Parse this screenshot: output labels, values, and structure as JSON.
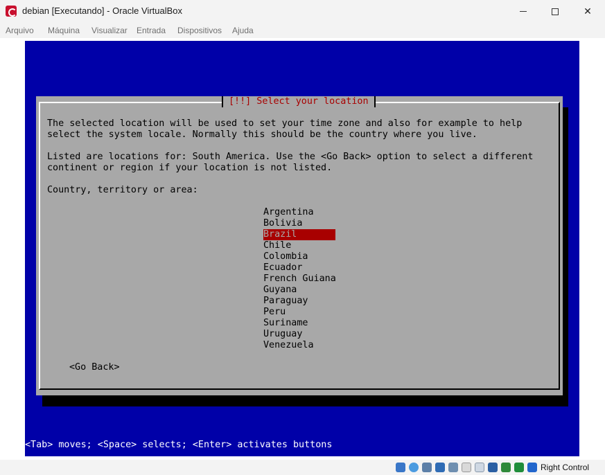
{
  "window": {
    "title": "debian [Executando] - Oracle VirtualBox",
    "minimize_glyph": "—",
    "maximize_glyph": "☐",
    "close_glyph": "✕"
  },
  "menu": [
    "Arquivo",
    "Máquina",
    "Visualizar",
    "Entrada",
    "Dispositivos",
    "Ajuda"
  ],
  "installer": {
    "dialog_title": "[!!] Select your location",
    "intro_lines": [
      "The selected location will be used to set your time zone and also for example to help",
      "select the system locale. Normally this should be the country where you live."
    ],
    "listed_lines": [
      "Listed are locations for: South America. Use the <Go Back> option to select a different",
      "continent or region if your location is not listed."
    ],
    "prompt": "Country, territory or area:",
    "countries": [
      "Argentina",
      "Bolivia",
      "Brazil",
      "Chile",
      "Colombia",
      "Ecuador",
      "French Guiana",
      "Guyana",
      "Paraguay",
      "Peru",
      "Suriname",
      "Uruguay",
      "Venezuela"
    ],
    "selected_country": "Brazil",
    "go_back_label": "<Go Back>",
    "help_line": "<Tab> moves; <Space> selects; <Enter> activates buttons",
    "colors": {
      "background": "#0000a8",
      "dialog": "#a8a8a8",
      "title_text": "#a80000",
      "selection": "#a80000"
    }
  },
  "statusbar": {
    "icons": [
      "hard-disk-icon",
      "optical-drive-icon",
      "audio-icon",
      "network-icon",
      "usb-icon",
      "shared-folders-icon",
      "display-icon",
      "video-capture-icon",
      "recording-icon",
      "cpu-icon",
      "guest-additions-icon",
      "mouse-integration-icon",
      "keyboard-capture-icon"
    ],
    "host_key": "Right Control"
  }
}
